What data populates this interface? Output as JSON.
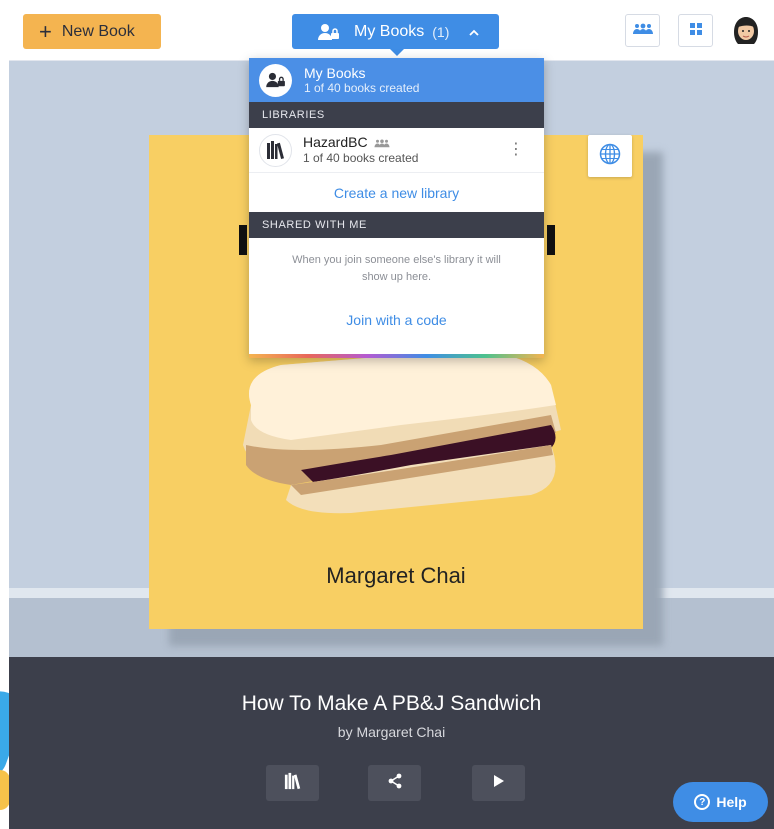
{
  "topbar": {
    "new_book_label": "New Book",
    "my_books_label": "My Books",
    "my_books_count": "(1)"
  },
  "dropdown": {
    "header": {
      "title": "My Books",
      "subtitle": "1 of 40 books created"
    },
    "libraries_section": "LIBRARIES",
    "library": {
      "name": "HazardBC",
      "subtitle": "1 of 40 books created"
    },
    "create_library_link": "Create a new library",
    "shared_section": "SHARED WITH ME",
    "shared_empty_text": "When you join someone else's library it will show up here.",
    "join_link": "Join with a code"
  },
  "cover": {
    "author": "Margaret Chai"
  },
  "footer": {
    "book_title": "How To Make A PB&J Sandwich",
    "byline": "by Margaret Chai",
    "help_label": "Help"
  },
  "colors": {
    "accent_blue": "#3f8de5",
    "new_book_orange": "#f4b450",
    "cover_yellow": "#f8cf63",
    "footer_dark": "#3c3f4b"
  }
}
